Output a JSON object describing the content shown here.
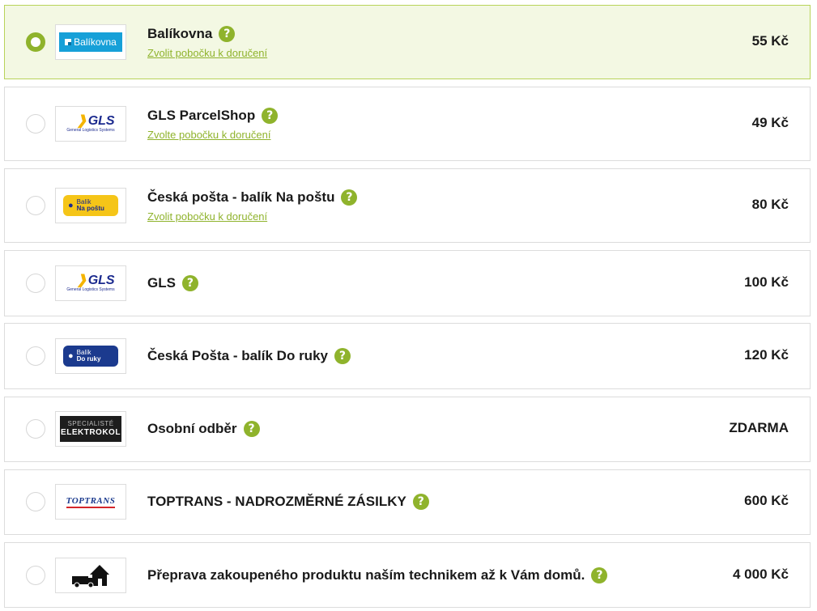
{
  "options": [
    {
      "id": "balikovna",
      "title": "Balíkovna",
      "branch_link": "Zvolit pobočku k doručení",
      "price": "55 Kč",
      "selected": true,
      "logo": {
        "type": "balikovna",
        "text": "Balíkovna"
      }
    },
    {
      "id": "gls-parcelshop",
      "title": "GLS ParcelShop",
      "branch_link": "Zvolte pobočku k doručení",
      "price": "49 Kč",
      "selected": false,
      "logo": {
        "type": "gls",
        "text": "GLS",
        "subtext": "General Logistics Systems"
      }
    },
    {
      "id": "ceska-posta-na-postu",
      "title": "Česká pošta - balík Na poštu",
      "branch_link": "Zvolit pobočku k doručení",
      "price": "80 Kč",
      "selected": false,
      "logo": {
        "type": "cp-yellow",
        "line1": "Balík",
        "line2": "Na poštu"
      }
    },
    {
      "id": "gls",
      "title": "GLS",
      "branch_link": "",
      "price": "100 Kč",
      "selected": false,
      "logo": {
        "type": "gls",
        "text": "GLS",
        "subtext": "General Logistics Systems"
      }
    },
    {
      "id": "ceska-posta-do-ruky",
      "title": "Česká Pošta - balík Do ruky",
      "branch_link": "",
      "price": "120 Kč",
      "selected": false,
      "logo": {
        "type": "cp-blue",
        "line1": "Balík",
        "line2": "Do ruky"
      }
    },
    {
      "id": "osobni-odber",
      "title": "Osobní odběr",
      "branch_link": "",
      "price": "ZDARMA",
      "selected": false,
      "logo": {
        "type": "elektrokol",
        "line1": "SPECIALISTÉ",
        "line2": "ELEKTROKOL"
      }
    },
    {
      "id": "toptrans",
      "title": "TOPTRANS - NADROZMĚRNÉ ZÁSILKY",
      "branch_link": "",
      "price": "600 Kč",
      "selected": false,
      "logo": {
        "type": "toptrans",
        "text": "TOPTRANS"
      }
    },
    {
      "id": "preprava-technik",
      "title": "Přeprava zakoupeného produktu naším technikem až k Vám domů.",
      "branch_link": "",
      "price": "4 000 Kč",
      "selected": false,
      "logo": {
        "type": "van-house-icon"
      }
    }
  ],
  "help_glyph": "?",
  "colors": {
    "accent": "#8fb32c",
    "selected_bg": "#f3f8e3",
    "selected_border": "#b8d35a",
    "border": "#dcdcdc",
    "text": "#1a1a1a"
  }
}
